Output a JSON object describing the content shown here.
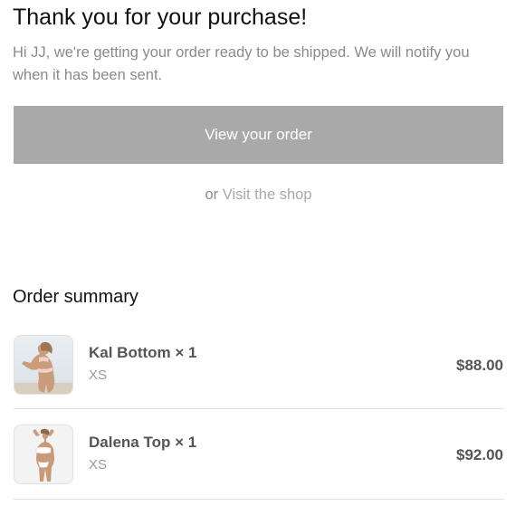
{
  "header": {
    "title": "Thank you for your purchase!",
    "message": "Hi JJ, we're getting your order ready to be shipped. We will notify you when it has been sent."
  },
  "actions": {
    "view_order_label": "View your order",
    "or_label": "or",
    "visit_shop_label": "Visit the shop"
  },
  "summary": {
    "title": "Order summary",
    "items": [
      {
        "name": "Kal Bottom × 1",
        "variant": "XS",
        "price": "$88.00",
        "image_icon": "product-thumbnail"
      },
      {
        "name": "Dalena Top × 1",
        "variant": "XS",
        "price": "$92.00",
        "image_icon": "product-thumbnail"
      }
    ]
  },
  "colors": {
    "button_bg": "#a9a9a9",
    "button_text": "#ffffff",
    "muted_text": "#8a8a8a",
    "link_text": "#a9a9a9",
    "divider": "#e1e1e1"
  }
}
